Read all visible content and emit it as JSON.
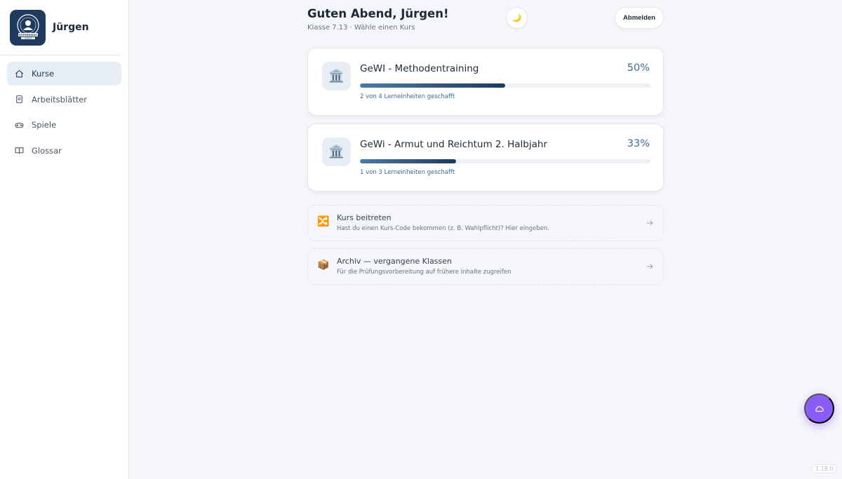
{
  "sidebar": {
    "user_name": "Jürgen",
    "logo_text": "KOPERNIKUS LERNAPP",
    "items": [
      {
        "label": "Kurse",
        "icon": "home-icon",
        "active": true
      },
      {
        "label": "Arbeitsblätter",
        "icon": "clipboard-icon",
        "active": false
      },
      {
        "label": "Spiele",
        "icon": "gamepad-icon",
        "active": false
      },
      {
        "label": "Glossar",
        "icon": "book-icon",
        "active": false
      }
    ]
  },
  "header": {
    "greeting": "Guten Abend, Jürgen!",
    "subtitle": "Klasse 7.13 · Wähle einen Kurs",
    "theme_icon": "🌙",
    "logout_label": "Abmelden"
  },
  "courses": [
    {
      "title": "GeWI - Methodentraining",
      "percent_label": "50%",
      "progress": 0.5,
      "progress_text": "2 von 4 Lerneinheiten geschafft",
      "icon": "🏛️"
    },
    {
      "title": "GeWi - Armut und Reichtum 2. Halbjahr",
      "percent_label": "33%",
      "progress": 0.33,
      "progress_text": "1 von 3 Lerneinheiten geschafft",
      "icon": "🏛️"
    }
  ],
  "actions": [
    {
      "title": "Kurs beitreten",
      "subtitle": "Hast du einen Kurs-Code bekommen (z. B. Wahlpflicht)? Hier eingeben.",
      "icon": "🔀"
    },
    {
      "title": "Archiv — vergangene Klassen",
      "subtitle": "Für die Prüfungsvorbereitung auf frühere Inhalte zugreifen",
      "icon": "📦"
    }
  ],
  "version": "1.18.0",
  "colors": {
    "accent": "#1e3a5f",
    "fab": "#8b5cf6",
    "progress": "#3b6a98"
  }
}
